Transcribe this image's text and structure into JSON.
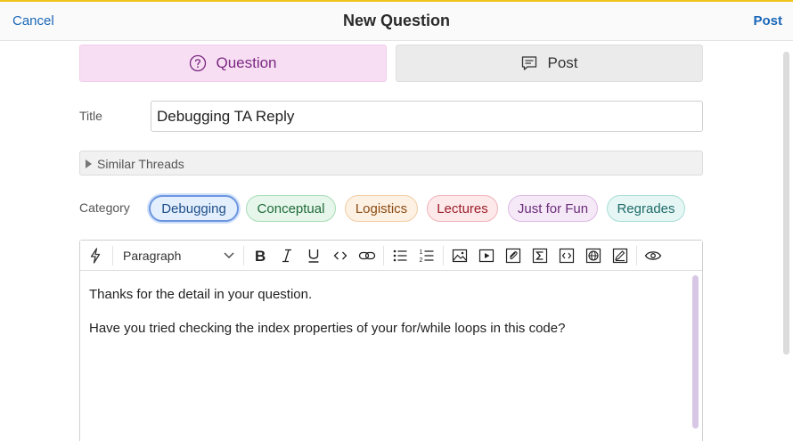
{
  "header": {
    "cancel_label": "Cancel",
    "title": "New Question",
    "post_label": "Post"
  },
  "post_type": {
    "question_label": "Question",
    "post_label": "Post",
    "selected": "Question"
  },
  "form": {
    "title_label": "Title",
    "title_value": "Debugging TA Reply",
    "similar_threads_label": "Similar Threads",
    "category_label": "Category"
  },
  "categories": [
    {
      "label": "Debugging",
      "selected": true,
      "color": "#1f4f8a",
      "bg": "#e3effc",
      "border": "#6d96df"
    },
    {
      "label": "Conceptual",
      "selected": false,
      "color": "#1f6b3a",
      "bg": "#e6f6ea",
      "border": "#a7dcb6"
    },
    {
      "label": "Logistics",
      "selected": false,
      "color": "#8a4a12",
      "bg": "#fdf1e3",
      "border": "#f1cca3"
    },
    {
      "label": "Lectures",
      "selected": false,
      "color": "#9b1f2a",
      "bg": "#fde8ea",
      "border": "#f0b2b8"
    },
    {
      "label": "Just for Fun",
      "selected": false,
      "color": "#6b2d7a",
      "bg": "#f5e8f7",
      "border": "#dcb9e3"
    },
    {
      "label": "Regrades",
      "selected": false,
      "color": "#1f6b68",
      "bg": "#e5f6f4",
      "border": "#a7ddd6"
    }
  ],
  "editor": {
    "block_format": "Paragraph",
    "toolbar_icons": [
      "lightning-icon",
      "bold-icon",
      "italic-icon",
      "underline-icon",
      "inline-code-icon",
      "link-icon",
      "bullet-list-icon",
      "numbered-list-icon",
      "image-icon",
      "video-icon",
      "attachment-icon",
      "sigma-icon",
      "code-block-icon",
      "globe-icon",
      "pen-icon",
      "eye-icon"
    ],
    "paragraphs": [
      "Thanks for the detail in your question.",
      "Have you tried checking the index properties of your for/while loops in this code?"
    ]
  },
  "colors": {
    "link_blue": "#1a66b8",
    "accent_yellow": "#f0c419",
    "question_tab_bg": "#f8def3"
  }
}
